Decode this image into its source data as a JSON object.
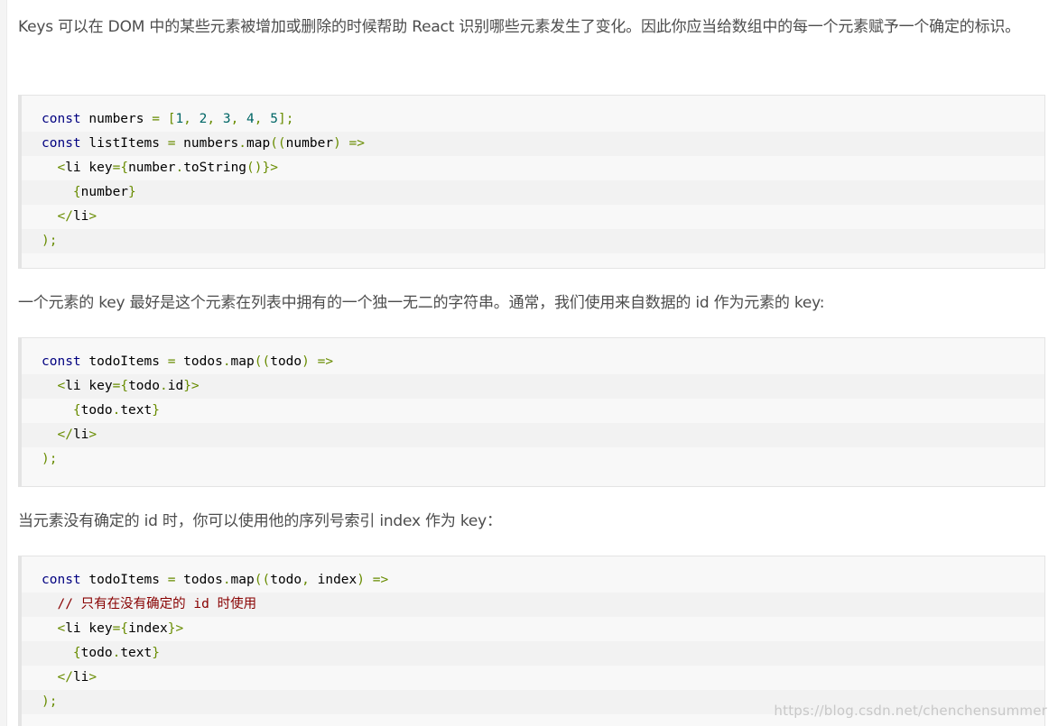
{
  "paragraphs": [
    "Keys 可以在 DOM 中的某些元素被增加或删除的时候帮助 React 识别哪些元素发生了变化。因此你应当给数组中的每一个元素赋予一个确定的标识。",
    "一个元素的 key 最好是这个元素在列表中拥有的一个独一无二的字符串。通常，我们使用来自数据的 id 作为元素的 key:",
    "当元素没有确定的 id 时，你可以使用他的序列号索引 index 作为 key："
  ],
  "code_blocks": [
    {
      "lines": [
        [
          [
            "kw",
            "const"
          ],
          [
            "pl",
            " numbers "
          ],
          [
            "op",
            "="
          ],
          [
            "pl",
            " "
          ],
          [
            "op",
            "["
          ],
          [
            "num",
            "1"
          ],
          [
            "op",
            ","
          ],
          [
            "pl",
            " "
          ],
          [
            "num",
            "2"
          ],
          [
            "op",
            ","
          ],
          [
            "pl",
            " "
          ],
          [
            "num",
            "3"
          ],
          [
            "op",
            ","
          ],
          [
            "pl",
            " "
          ],
          [
            "num",
            "4"
          ],
          [
            "op",
            ","
          ],
          [
            "pl",
            " "
          ],
          [
            "num",
            "5"
          ],
          [
            "op",
            "];"
          ]
        ],
        [
          [
            "kw",
            "const"
          ],
          [
            "pl",
            " listItems "
          ],
          [
            "op",
            "="
          ],
          [
            "pl",
            " numbers"
          ],
          [
            "op",
            "."
          ],
          [
            "pl",
            "map"
          ],
          [
            "op",
            "(("
          ],
          [
            "pl",
            "number"
          ],
          [
            "op",
            ")"
          ],
          [
            "pl",
            " "
          ],
          [
            "op",
            "=>"
          ]
        ],
        [
          [
            "pl",
            "  "
          ],
          [
            "op",
            "<"
          ],
          [
            "pl",
            "li key"
          ],
          [
            "op",
            "={"
          ],
          [
            "pl",
            "number"
          ],
          [
            "op",
            "."
          ],
          [
            "pl",
            "toString"
          ],
          [
            "op",
            "()}>"
          ]
        ],
        [
          [
            "pl",
            "    "
          ],
          [
            "op",
            "{"
          ],
          [
            "pl",
            "number"
          ],
          [
            "op",
            "}"
          ]
        ],
        [
          [
            "pl",
            "  "
          ],
          [
            "op",
            "</"
          ],
          [
            "pl",
            "li"
          ],
          [
            "op",
            ">"
          ]
        ],
        [
          [
            "op",
            ");"
          ]
        ]
      ]
    },
    {
      "lines": [
        [
          [
            "kw",
            "const"
          ],
          [
            "pl",
            " todoItems "
          ],
          [
            "op",
            "="
          ],
          [
            "pl",
            " todos"
          ],
          [
            "op",
            "."
          ],
          [
            "pl",
            "map"
          ],
          [
            "op",
            "(("
          ],
          [
            "pl",
            "todo"
          ],
          [
            "op",
            ")"
          ],
          [
            "pl",
            " "
          ],
          [
            "op",
            "=>"
          ]
        ],
        [
          [
            "pl",
            "  "
          ],
          [
            "op",
            "<"
          ],
          [
            "pl",
            "li key"
          ],
          [
            "op",
            "={"
          ],
          [
            "pl",
            "todo"
          ],
          [
            "op",
            "."
          ],
          [
            "pl",
            "id"
          ],
          [
            "op",
            "}>"
          ]
        ],
        [
          [
            "pl",
            "    "
          ],
          [
            "op",
            "{"
          ],
          [
            "pl",
            "todo"
          ],
          [
            "op",
            "."
          ],
          [
            "pl",
            "text"
          ],
          [
            "op",
            "}"
          ]
        ],
        [
          [
            "pl",
            "  "
          ],
          [
            "op",
            "</"
          ],
          [
            "pl",
            "li"
          ],
          [
            "op",
            ">"
          ]
        ],
        [
          [
            "op",
            ");"
          ]
        ]
      ]
    },
    {
      "lines": [
        [
          [
            "kw",
            "const"
          ],
          [
            "pl",
            " todoItems "
          ],
          [
            "op",
            "="
          ],
          [
            "pl",
            " todos"
          ],
          [
            "op",
            "."
          ],
          [
            "pl",
            "map"
          ],
          [
            "op",
            "(("
          ],
          [
            "pl",
            "todo"
          ],
          [
            "op",
            ","
          ],
          [
            "pl",
            " index"
          ],
          [
            "op",
            ")"
          ],
          [
            "pl",
            " "
          ],
          [
            "op",
            "=>"
          ]
        ],
        [
          [
            "pl",
            "  "
          ],
          [
            "cm",
            "// 只有在没有确定的 id 时使用"
          ]
        ],
        [
          [
            "pl",
            "  "
          ],
          [
            "op",
            "<"
          ],
          [
            "pl",
            "li key"
          ],
          [
            "op",
            "={"
          ],
          [
            "pl",
            "index"
          ],
          [
            "op",
            "}>"
          ]
        ],
        [
          [
            "pl",
            "    "
          ],
          [
            "op",
            "{"
          ],
          [
            "pl",
            "todo"
          ],
          [
            "op",
            "."
          ],
          [
            "pl",
            "text"
          ],
          [
            "op",
            "}"
          ]
        ],
        [
          [
            "pl",
            "  "
          ],
          [
            "op",
            "</"
          ],
          [
            "pl",
            "li"
          ],
          [
            "op",
            ">"
          ]
        ],
        [
          [
            "op",
            ");"
          ]
        ]
      ]
    }
  ],
  "watermark": "https://blog.csdn.net/chenchensummer",
  "colors": {
    "text": "#4d4d4d",
    "code_bg": "#f8f8f8",
    "code_stripe": "#f2f2f2",
    "keyword": "#000080",
    "operator": "#688c00",
    "number": "#006666",
    "comment": "#880000"
  }
}
